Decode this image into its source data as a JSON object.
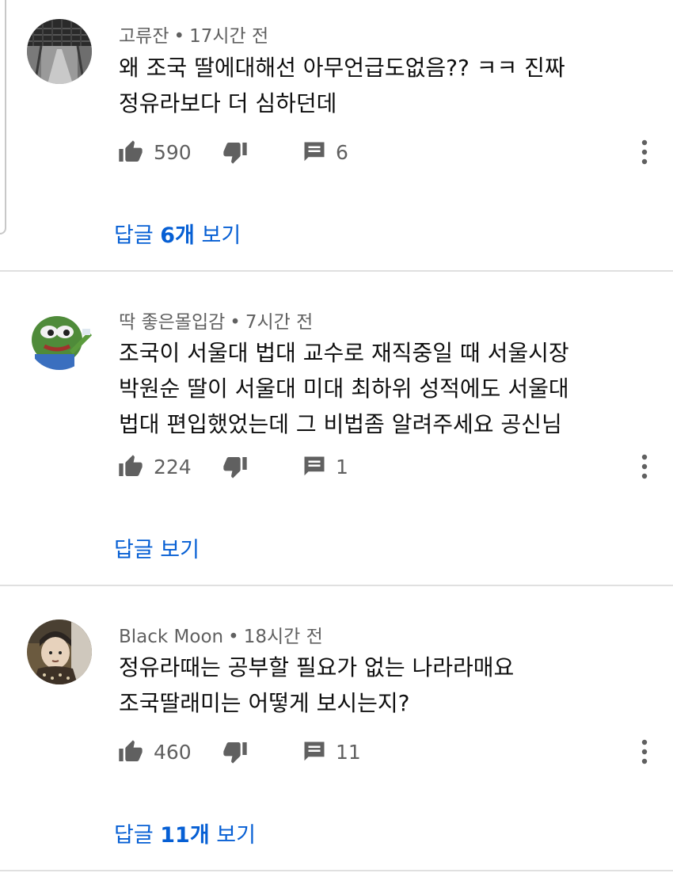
{
  "comments": [
    {
      "author": "고류잔",
      "time": "17시간 전",
      "lines": [
        "왜 조국 딸에대해선 아무언급도없음?? ㅋㅋ 진짜",
        "정유라보다 더 심하던데"
      ],
      "likes": "590",
      "replies_count": "6",
      "replies_link_prefix": "답글 ",
      "replies_link_count": "6개",
      "replies_link_suffix": " 보기"
    },
    {
      "author": "딱 좋은몰입감",
      "time": "7시간 전",
      "lines": [
        "조국이 서울대 법대 교수로 재직중일 때 서울시장",
        "박원순 딸이 서울대 미대 최하위 성적에도 서울대",
        "법대 편입했었는데 그 비법좀 알려주세요 공신님"
      ],
      "likes": "224",
      "replies_count": "1",
      "replies_link_prefix": "답글 보기",
      "replies_link_count": "",
      "replies_link_suffix": ""
    },
    {
      "author": "Black Moon",
      "time": "18시간 전",
      "lines": [
        "정유라때는 공부할 필요가 없는 나라라매요",
        "조국딸래미는 어떻게 보시는지?"
      ],
      "likes": "460",
      "replies_count": "11",
      "replies_link_prefix": "답글 ",
      "replies_link_count": "11개",
      "replies_link_suffix": " 보기"
    }
  ],
  "separator": "•",
  "icons": {
    "like": "thumb-up-icon",
    "dislike": "thumb-down-icon",
    "reply": "comment-icon",
    "more": "more-vert-icon"
  },
  "colors": {
    "link": "#065fd4",
    "meta": "#606060",
    "icon": "#606060"
  }
}
